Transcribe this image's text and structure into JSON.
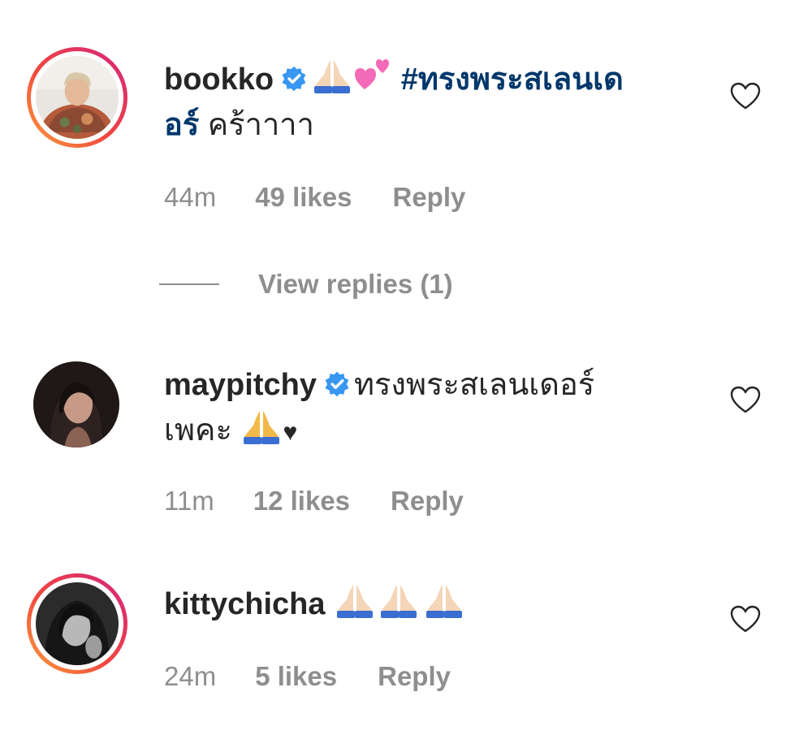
{
  "comments": [
    {
      "username": "bookko",
      "verified": true,
      "text_prefix_emoji": [
        "folded-hands-emoji",
        "two-hearts-emoji"
      ],
      "hashtag": "#ทรงพระสเลนเด",
      "hashtag_cont": "อร์",
      "text": " คร้าาาา",
      "time": "44m",
      "likes": "49 likes",
      "reply": "Reply",
      "view_replies": "View replies (1)"
    },
    {
      "username": "maypitchy",
      "verified": true,
      "text_line1": "ทรงพระสเลนเดอร์",
      "text_line2": "เพคะ",
      "suffix": "♥",
      "time": "11m",
      "likes": "12 likes",
      "reply": "Reply"
    },
    {
      "username": "kittychicha",
      "verified": false,
      "emoji": [
        "folded-hands-emoji",
        "folded-hands-emoji",
        "folded-hands-emoji"
      ],
      "time": "24m",
      "likes": "5 likes",
      "reply": "Reply"
    }
  ],
  "colors": {
    "text": "#262626",
    "secondary": "#8e8e8e",
    "hashtag": "#00376b",
    "verified": "#3897f0"
  }
}
